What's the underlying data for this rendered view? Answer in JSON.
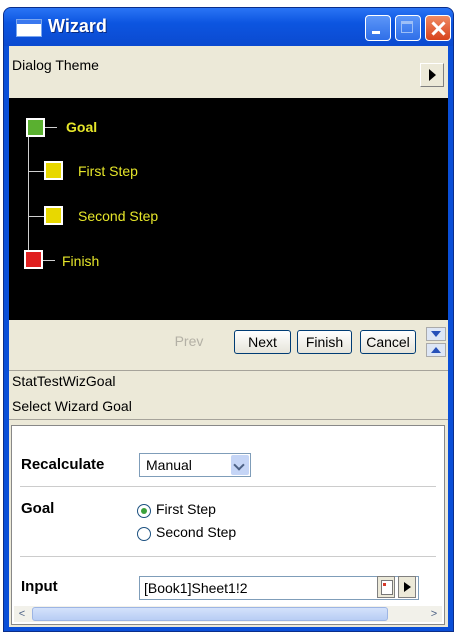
{
  "window": {
    "title": "Wizard"
  },
  "theme": {
    "label": "Dialog Theme"
  },
  "tree": {
    "nodes": [
      {
        "label": "Goal",
        "color": "#5ab030",
        "bold": true
      },
      {
        "label": "First Step",
        "color": "#e8d800",
        "bold": false
      },
      {
        "label": "Second Step",
        "color": "#e8d800",
        "bold": false
      },
      {
        "label": "Finish",
        "color": "#e02020",
        "bold": false
      }
    ]
  },
  "nav": {
    "prev": "Prev",
    "next": "Next",
    "finish": "Finish",
    "cancel": "Cancel"
  },
  "info": {
    "name": "StatTestWizGoal",
    "description": "Select Wizard Goal"
  },
  "form": {
    "recalculate": {
      "label": "Recalculate",
      "value": "Manual"
    },
    "goal": {
      "label": "Goal",
      "options": [
        "First Step",
        "Second Step"
      ],
      "selected": "First Step"
    },
    "input": {
      "label": "Input",
      "value": "[Book1]Sheet1!2"
    }
  }
}
